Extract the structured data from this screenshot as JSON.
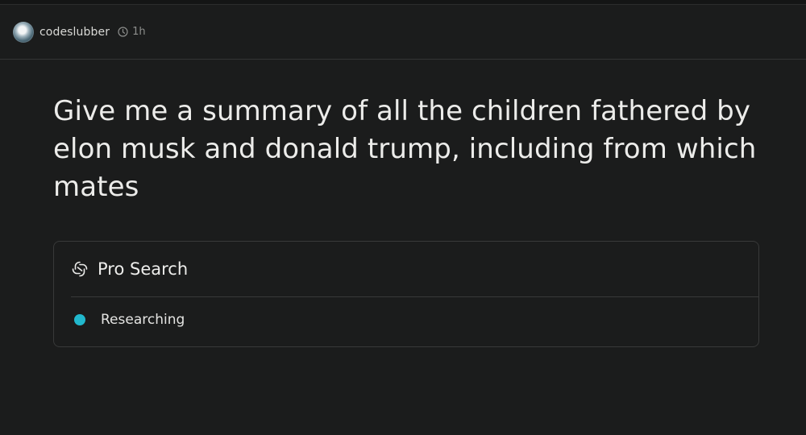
{
  "header": {
    "username": "codeslubber",
    "time": "1h",
    "avatar_icon": "user-avatar",
    "clock_icon": "clock-icon"
  },
  "thread": {
    "query": "Give me a summary of all the children fathered by elon musk and donald trump, including from which mates"
  },
  "pro_search": {
    "title": "Pro Search",
    "icon": "pro-search-icon",
    "steps": [
      {
        "label": "Researching",
        "status": "in-progress",
        "color": "#21b8cd"
      }
    ]
  },
  "colors": {
    "background": "#1b1c1c",
    "accent": "#21b8cd",
    "border": "#383939"
  }
}
